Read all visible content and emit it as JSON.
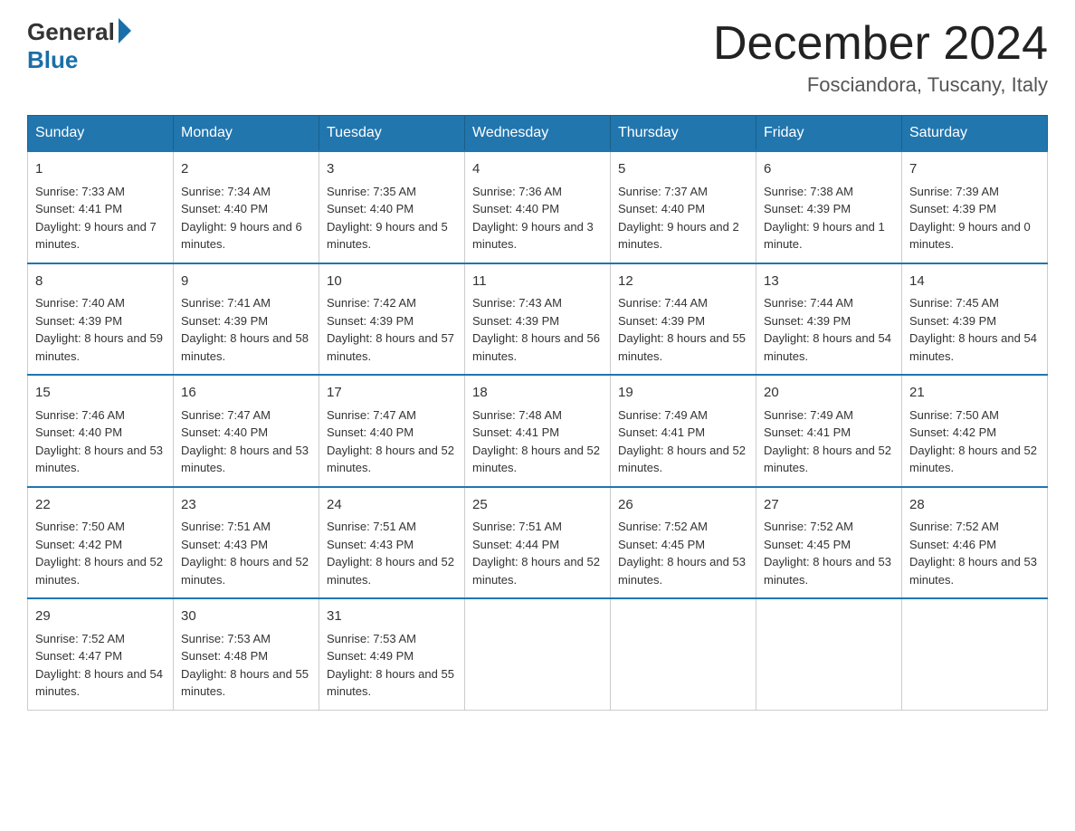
{
  "logo": {
    "general": "General",
    "blue": "Blue"
  },
  "header": {
    "month_title": "December 2024",
    "location": "Fosciandora, Tuscany, Italy"
  },
  "days_of_week": [
    "Sunday",
    "Monday",
    "Tuesday",
    "Wednesday",
    "Thursday",
    "Friday",
    "Saturday"
  ],
  "weeks": [
    [
      {
        "day": "1",
        "sunrise": "7:33 AM",
        "sunset": "4:41 PM",
        "daylight": "9 hours and 7 minutes."
      },
      {
        "day": "2",
        "sunrise": "7:34 AM",
        "sunset": "4:40 PM",
        "daylight": "9 hours and 6 minutes."
      },
      {
        "day": "3",
        "sunrise": "7:35 AM",
        "sunset": "4:40 PM",
        "daylight": "9 hours and 5 minutes."
      },
      {
        "day": "4",
        "sunrise": "7:36 AM",
        "sunset": "4:40 PM",
        "daylight": "9 hours and 3 minutes."
      },
      {
        "day": "5",
        "sunrise": "7:37 AM",
        "sunset": "4:40 PM",
        "daylight": "9 hours and 2 minutes."
      },
      {
        "day": "6",
        "sunrise": "7:38 AM",
        "sunset": "4:39 PM",
        "daylight": "9 hours and 1 minute."
      },
      {
        "day": "7",
        "sunrise": "7:39 AM",
        "sunset": "4:39 PM",
        "daylight": "9 hours and 0 minutes."
      }
    ],
    [
      {
        "day": "8",
        "sunrise": "7:40 AM",
        "sunset": "4:39 PM",
        "daylight": "8 hours and 59 minutes."
      },
      {
        "day": "9",
        "sunrise": "7:41 AM",
        "sunset": "4:39 PM",
        "daylight": "8 hours and 58 minutes."
      },
      {
        "day": "10",
        "sunrise": "7:42 AM",
        "sunset": "4:39 PM",
        "daylight": "8 hours and 57 minutes."
      },
      {
        "day": "11",
        "sunrise": "7:43 AM",
        "sunset": "4:39 PM",
        "daylight": "8 hours and 56 minutes."
      },
      {
        "day": "12",
        "sunrise": "7:44 AM",
        "sunset": "4:39 PM",
        "daylight": "8 hours and 55 minutes."
      },
      {
        "day": "13",
        "sunrise": "7:44 AM",
        "sunset": "4:39 PM",
        "daylight": "8 hours and 54 minutes."
      },
      {
        "day": "14",
        "sunrise": "7:45 AM",
        "sunset": "4:39 PM",
        "daylight": "8 hours and 54 minutes."
      }
    ],
    [
      {
        "day": "15",
        "sunrise": "7:46 AM",
        "sunset": "4:40 PM",
        "daylight": "8 hours and 53 minutes."
      },
      {
        "day": "16",
        "sunrise": "7:47 AM",
        "sunset": "4:40 PM",
        "daylight": "8 hours and 53 minutes."
      },
      {
        "day": "17",
        "sunrise": "7:47 AM",
        "sunset": "4:40 PM",
        "daylight": "8 hours and 52 minutes."
      },
      {
        "day": "18",
        "sunrise": "7:48 AM",
        "sunset": "4:41 PM",
        "daylight": "8 hours and 52 minutes."
      },
      {
        "day": "19",
        "sunrise": "7:49 AM",
        "sunset": "4:41 PM",
        "daylight": "8 hours and 52 minutes."
      },
      {
        "day": "20",
        "sunrise": "7:49 AM",
        "sunset": "4:41 PM",
        "daylight": "8 hours and 52 minutes."
      },
      {
        "day": "21",
        "sunrise": "7:50 AM",
        "sunset": "4:42 PM",
        "daylight": "8 hours and 52 minutes."
      }
    ],
    [
      {
        "day": "22",
        "sunrise": "7:50 AM",
        "sunset": "4:42 PM",
        "daylight": "8 hours and 52 minutes."
      },
      {
        "day": "23",
        "sunrise": "7:51 AM",
        "sunset": "4:43 PM",
        "daylight": "8 hours and 52 minutes."
      },
      {
        "day": "24",
        "sunrise": "7:51 AM",
        "sunset": "4:43 PM",
        "daylight": "8 hours and 52 minutes."
      },
      {
        "day": "25",
        "sunrise": "7:51 AM",
        "sunset": "4:44 PM",
        "daylight": "8 hours and 52 minutes."
      },
      {
        "day": "26",
        "sunrise": "7:52 AM",
        "sunset": "4:45 PM",
        "daylight": "8 hours and 53 minutes."
      },
      {
        "day": "27",
        "sunrise": "7:52 AM",
        "sunset": "4:45 PM",
        "daylight": "8 hours and 53 minutes."
      },
      {
        "day": "28",
        "sunrise": "7:52 AM",
        "sunset": "4:46 PM",
        "daylight": "8 hours and 53 minutes."
      }
    ],
    [
      {
        "day": "29",
        "sunrise": "7:52 AM",
        "sunset": "4:47 PM",
        "daylight": "8 hours and 54 minutes."
      },
      {
        "day": "30",
        "sunrise": "7:53 AM",
        "sunset": "4:48 PM",
        "daylight": "8 hours and 55 minutes."
      },
      {
        "day": "31",
        "sunrise": "7:53 AM",
        "sunset": "4:49 PM",
        "daylight": "8 hours and 55 minutes."
      },
      null,
      null,
      null,
      null
    ]
  ]
}
